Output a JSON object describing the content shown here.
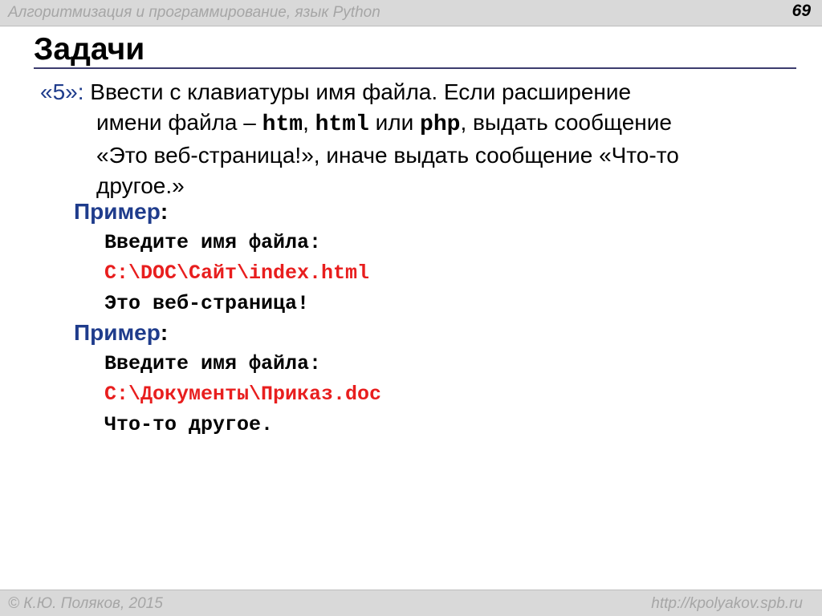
{
  "header": {
    "title": "Алгоритмизация и программирование, язык Python",
    "page_number": "69"
  },
  "slide": {
    "title": "Задачи",
    "task": {
      "number": "«5»:",
      "l1": " Ввести с клавиатуры имя файла. Если расширение",
      "l2a": "имени файла – ",
      "ext1": "htm",
      "comma": ", ",
      "ext2": "html",
      "or": " или ",
      "ext3": "php",
      "l2b": ", выдать сообщение",
      "l3": "«Это веб-страница!», иначе выдать сообщение «Что-то",
      "l4": "другое.»"
    },
    "examples": [
      {
        "label": "Пример",
        "colon": ":",
        "prompt": "Введите имя файла:",
        "input": "C:\\DOC\\Сайт\\index.html",
        "output": "Это веб-страница!"
      },
      {
        "label": "Пример",
        "colon": ":",
        "prompt": "Введите имя файла:",
        "input": "C:\\Документы\\Приказ.doc",
        "output": "Что-то другое."
      }
    ]
  },
  "footer": {
    "author": "© К.Ю. Поляков, 2015",
    "url": "http://kpolyakov.spb.ru"
  },
  "colors": {
    "accent_blue": "#1f3c8c",
    "input_red": "#e81e1e",
    "bar_gray": "#d9d9d9"
  }
}
